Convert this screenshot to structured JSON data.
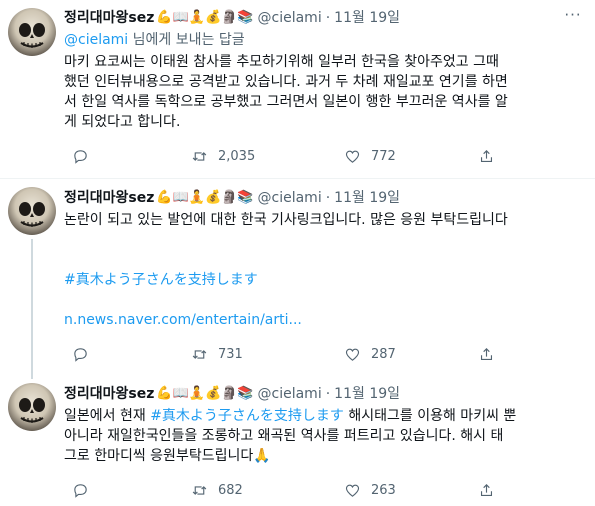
{
  "tweets": [
    {
      "name": "정리대마왕sez",
      "emojis": "💪📖🧘💰🗿📚",
      "handle": "@cielami",
      "dot": "·",
      "date": "11월 19일",
      "reply_prefix": "@cielami",
      "reply_suffix": " 님에게 보내는 답글",
      "text_lines": [
        "마키 요코씨는 이태원 참사를 추모하기위해 일부러 한국을 찾아주었고 그때",
        "했던 인터뷰내용으로 공격받고 있습니다. 과거 두 차례 재일교포 연기를 하면",
        "서 한일 역사를 독학으로 공부했고 그러면서 일본이 행한 부끄러운 역사를 알",
        "게 되었다고 합니다."
      ],
      "retweets": "2,035",
      "likes": "772"
    },
    {
      "name": "정리대마왕sez",
      "emojis": "💪📖🧘💰🗿📚",
      "handle": "@cielami",
      "dot": "·",
      "date": "11월 19일",
      "text_line": "논란이 되고 있는 발언에 대한 한국 기사링크입니다. 많은 응원 부탁드립니다",
      "hashtag": "#真木よう子さんを支持します",
      "url": "n.news.naver.com/entertain/arti...",
      "retweets": "731",
      "likes": "287"
    },
    {
      "name": "정리대마왕sez",
      "emojis": "💪📖🧘💰🗿📚",
      "handle": "@cielami",
      "dot": "·",
      "date": "11월 19일",
      "line1_prefix": "일본에서 현재 ",
      "line1_hashtag": "#真木よう子さんを支持します",
      "line1_suffix": " 해시태그를 이용해 마키씨 뿐",
      "line2": "아니라 재일한국인들을 조롱하고 왜곡된 역사를 퍼트리고 있습니다. 해시 태",
      "line3": "그로 한마디씩 응원부탁드립니다🙏",
      "retweets": "682",
      "likes": "263"
    }
  ],
  "icons": {
    "more": "more-icon",
    "reply": "reply-icon",
    "retweet": "retweet-icon",
    "like": "like-icon",
    "share": "share-icon"
  },
  "colors": {
    "accent": "#1d9bf0",
    "secondary_text": "#536471",
    "primary_text": "#0f1419"
  }
}
